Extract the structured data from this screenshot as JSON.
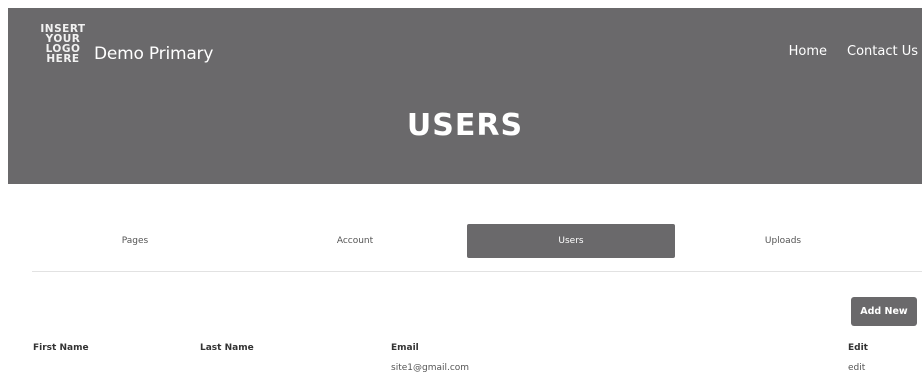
{
  "header": {
    "logo_lines": [
      "INSERT",
      "YOUR",
      "LOGO",
      "HERE"
    ],
    "site_title": "Demo Primary",
    "nav": [
      "Home",
      "Contact Us"
    ],
    "page_heading": "USERS",
    "background_color": "#6a696b"
  },
  "tabs": {
    "items": [
      "Pages",
      "Account",
      "Users",
      "Uploads"
    ],
    "active": "Users"
  },
  "toolbar": {
    "add_label": "Add New"
  },
  "table": {
    "columns": [
      "First Name",
      "Last Name",
      "Email",
      "Edit"
    ],
    "rows": [
      {
        "first_name": "",
        "last_name": "",
        "email": "site1@gmail.com",
        "edit": "edit"
      }
    ]
  }
}
